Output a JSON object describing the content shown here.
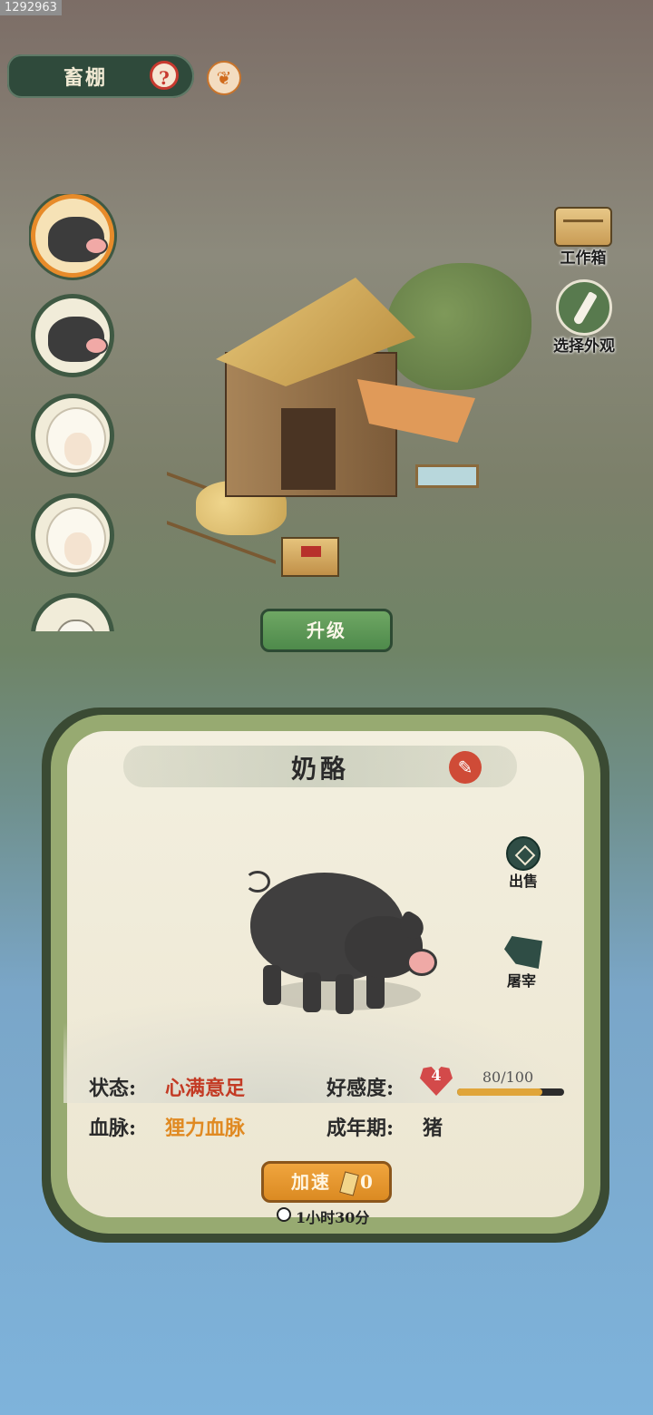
{
  "badge": {
    "id": "1292963"
  },
  "header": {
    "title": "畜棚",
    "help_glyph": "?",
    "phoenix_glyph": "❦"
  },
  "animals": [
    {
      "kind": "pig",
      "selected": true
    },
    {
      "kind": "pig",
      "selected": false
    },
    {
      "kind": "sheep",
      "selected": false
    },
    {
      "kind": "sheep",
      "selected": false
    },
    {
      "kind": "goat",
      "selected": false
    }
  ],
  "side_buttons": {
    "toolbox_label": "工作箱",
    "appearance_label": "选择外观"
  },
  "upgrade": {
    "label": "升级"
  },
  "panel": {
    "name": "奶酪",
    "rename_glyph": "✎",
    "sell_label": "出售",
    "slaughter_label": "屠宰",
    "status_label": "状态:",
    "status_value": "心满意足",
    "bloodline_label": "血脉:",
    "bloodline_value": "狸力血脉",
    "affinity_label": "好感度:",
    "affinity_level": "4",
    "affinity_text": "80/100",
    "affinity_fraction": 0.8,
    "adult_label": "成年期:",
    "adult_value": "猪",
    "speedup_label": "加速",
    "speedup_count": "0",
    "timer_text": "1小时30分"
  },
  "colors": {
    "accent_green": "#4e8a4b",
    "accent_orange": "#db8a22",
    "status_red": "#c33a24",
    "bloodline_orange": "#e08a22"
  }
}
